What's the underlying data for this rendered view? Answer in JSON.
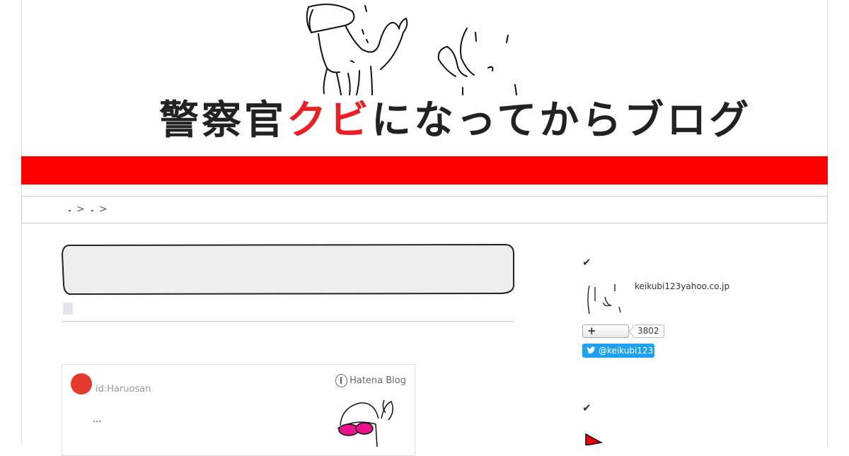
{
  "header": {
    "title_part1": "警察官",
    "title_red": "クビ",
    "title_part2": "になってからブログ"
  },
  "breadcrumb": {
    "separator1": ">",
    "separator2": ">"
  },
  "embed_card": {
    "author_id": "id:Haruosan",
    "brand": "Hatena Blog",
    "excerpt": "..."
  },
  "sidebar": {
    "profile": {
      "check_icon": "✔",
      "email": "keikubi123yahoo.co.jp",
      "follower_count": "3802",
      "twitter_handle": "@keikubi123"
    },
    "section2": {
      "check_icon": "✔"
    }
  },
  "colors": {
    "accent_red": "#ff0000",
    "title_red": "#ee1d23",
    "twitter_blue": "#1da1f2"
  }
}
